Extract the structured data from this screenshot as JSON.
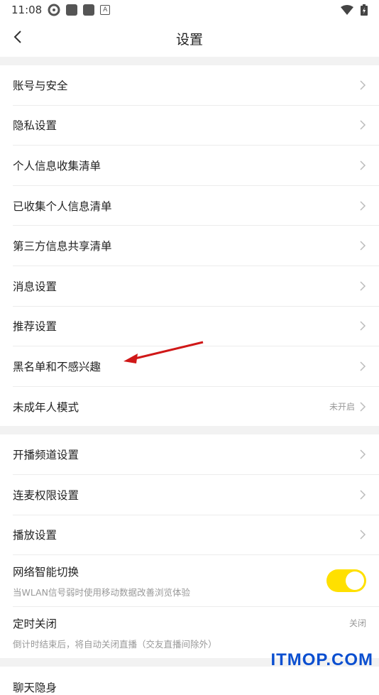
{
  "status_bar": {
    "time": "11:08",
    "icon_a": "A"
  },
  "header": {
    "title": "设置"
  },
  "group1": [
    {
      "label": "账号与安全"
    },
    {
      "label": "隐私设置"
    },
    {
      "label": "个人信息收集清单"
    },
    {
      "label": "已收集个人信息清单"
    },
    {
      "label": "第三方信息共享清单"
    },
    {
      "label": "消息设置"
    },
    {
      "label": "推荐设置"
    },
    {
      "label": "黑名单和不感兴趣"
    },
    {
      "label": "未成年人模式",
      "value": "未开启"
    }
  ],
  "group2": [
    {
      "label": "开播频道设置"
    },
    {
      "label": "连麦权限设置"
    },
    {
      "label": "播放设置"
    }
  ],
  "network": {
    "label": "网络智能切换",
    "desc": "当WLAN信号弱时使用移动数据改善浏览体验",
    "enabled": true
  },
  "timer": {
    "label": "定时关闭",
    "desc": "倒计时结束后，将自动关闭直播（交友直播间除外）",
    "value": "关闭"
  },
  "group3": [
    {
      "label": "聊天隐身"
    }
  ],
  "watermark": "ITMOP.COM",
  "colors": {
    "accent": "#ffe000",
    "arrow": "#d01818",
    "watermark": "#0b4fd0"
  }
}
